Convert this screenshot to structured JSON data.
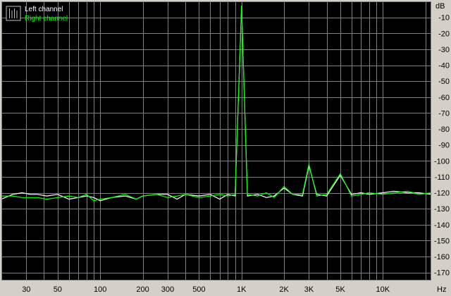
{
  "chart_data": {
    "type": "line",
    "x_scale": "log",
    "xlim": [
      20,
      22000
    ],
    "ylim": [
      -175,
      0
    ],
    "x_tick_values": [
      30,
      50,
      100,
      200,
      300,
      500,
      1000,
      2000,
      3000,
      5000,
      10000
    ],
    "x_tick_labels": [
      "30",
      "50",
      "100",
      "200",
      "300",
      "500",
      "1K",
      "2K",
      "3K",
      "5K",
      "10K"
    ],
    "x_unit": "Hz",
    "y_tick_values": [
      -10,
      -20,
      -30,
      -40,
      -50,
      -60,
      -70,
      -80,
      -90,
      -100,
      -110,
      -120,
      -130,
      -140,
      -150,
      -160,
      -170
    ],
    "y_tick_labels": [
      "-10",
      "-20",
      "-30",
      "-40",
      "-50",
      "-60",
      "-70",
      "-80",
      "-90",
      "-100",
      "-110",
      "-120",
      "-130",
      "-140",
      "-150",
      "-160",
      "-170"
    ],
    "y_unit": "dB",
    "grid": true,
    "legend_position": "top-left",
    "background_color": "#000000",
    "grid_color": "#808080",
    "series": [
      {
        "name": "Left channel",
        "color": "#ffffff",
        "points": [
          [
            20,
            -124
          ],
          [
            24,
            -121
          ],
          [
            28,
            -120
          ],
          [
            32,
            -121
          ],
          [
            36,
            -121
          ],
          [
            42,
            -122
          ],
          [
            50,
            -121
          ],
          [
            60,
            -124
          ],
          [
            70,
            -123
          ],
          [
            80,
            -122
          ],
          [
            90,
            -123
          ],
          [
            100,
            -125
          ],
          [
            120,
            -123
          ],
          [
            150,
            -122
          ],
          [
            180,
            -124
          ],
          [
            200,
            -122
          ],
          [
            250,
            -121
          ],
          [
            300,
            -121
          ],
          [
            350,
            -124
          ],
          [
            400,
            -121
          ],
          [
            500,
            -122
          ],
          [
            600,
            -121
          ],
          [
            700,
            -124
          ],
          [
            800,
            -121
          ],
          [
            900,
            -122
          ],
          [
            1000,
            -3
          ],
          [
            1100,
            -122
          ],
          [
            1300,
            -121
          ],
          [
            1500,
            -123
          ],
          [
            1700,
            -122
          ],
          [
            2000,
            -117
          ],
          [
            2300,
            -121
          ],
          [
            2700,
            -122
          ],
          [
            3000,
            -103
          ],
          [
            3400,
            -121
          ],
          [
            4000,
            -122
          ],
          [
            5000,
            -109
          ],
          [
            6000,
            -121
          ],
          [
            7000,
            -120
          ],
          [
            8000,
            -121
          ],
          [
            10000,
            -120
          ],
          [
            12000,
            -119
          ],
          [
            15000,
            -120
          ],
          [
            18000,
            -120
          ],
          [
            22000,
            -121
          ]
        ]
      },
      {
        "name": "Right channel",
        "color": "#00ff00",
        "points": [
          [
            20,
            -122
          ],
          [
            24,
            -122
          ],
          [
            28,
            -123
          ],
          [
            32,
            -123
          ],
          [
            36,
            -123
          ],
          [
            42,
            -124
          ],
          [
            50,
            -123
          ],
          [
            60,
            -122
          ],
          [
            70,
            -123
          ],
          [
            80,
            -121
          ],
          [
            90,
            -125
          ],
          [
            100,
            -124
          ],
          [
            120,
            -123
          ],
          [
            150,
            -121
          ],
          [
            180,
            -124
          ],
          [
            200,
            -122
          ],
          [
            250,
            -121
          ],
          [
            300,
            -123
          ],
          [
            350,
            -122
          ],
          [
            400,
            -121
          ],
          [
            500,
            -123
          ],
          [
            600,
            -122
          ],
          [
            700,
            -121
          ],
          [
            800,
            -122
          ],
          [
            900,
            -121
          ],
          [
            1000,
            -3
          ],
          [
            1100,
            -121
          ],
          [
            1300,
            -122
          ],
          [
            1500,
            -120
          ],
          [
            1700,
            -123
          ],
          [
            2000,
            -116
          ],
          [
            2300,
            -121
          ],
          [
            2700,
            -121
          ],
          [
            3000,
            -102
          ],
          [
            3400,
            -122
          ],
          [
            4000,
            -121
          ],
          [
            5000,
            -108
          ],
          [
            6000,
            -122
          ],
          [
            7000,
            -121
          ],
          [
            8000,
            -120
          ],
          [
            10000,
            -121
          ],
          [
            12000,
            -120
          ],
          [
            15000,
            -119
          ],
          [
            18000,
            -121
          ],
          [
            22000,
            -120
          ]
        ]
      }
    ]
  }
}
